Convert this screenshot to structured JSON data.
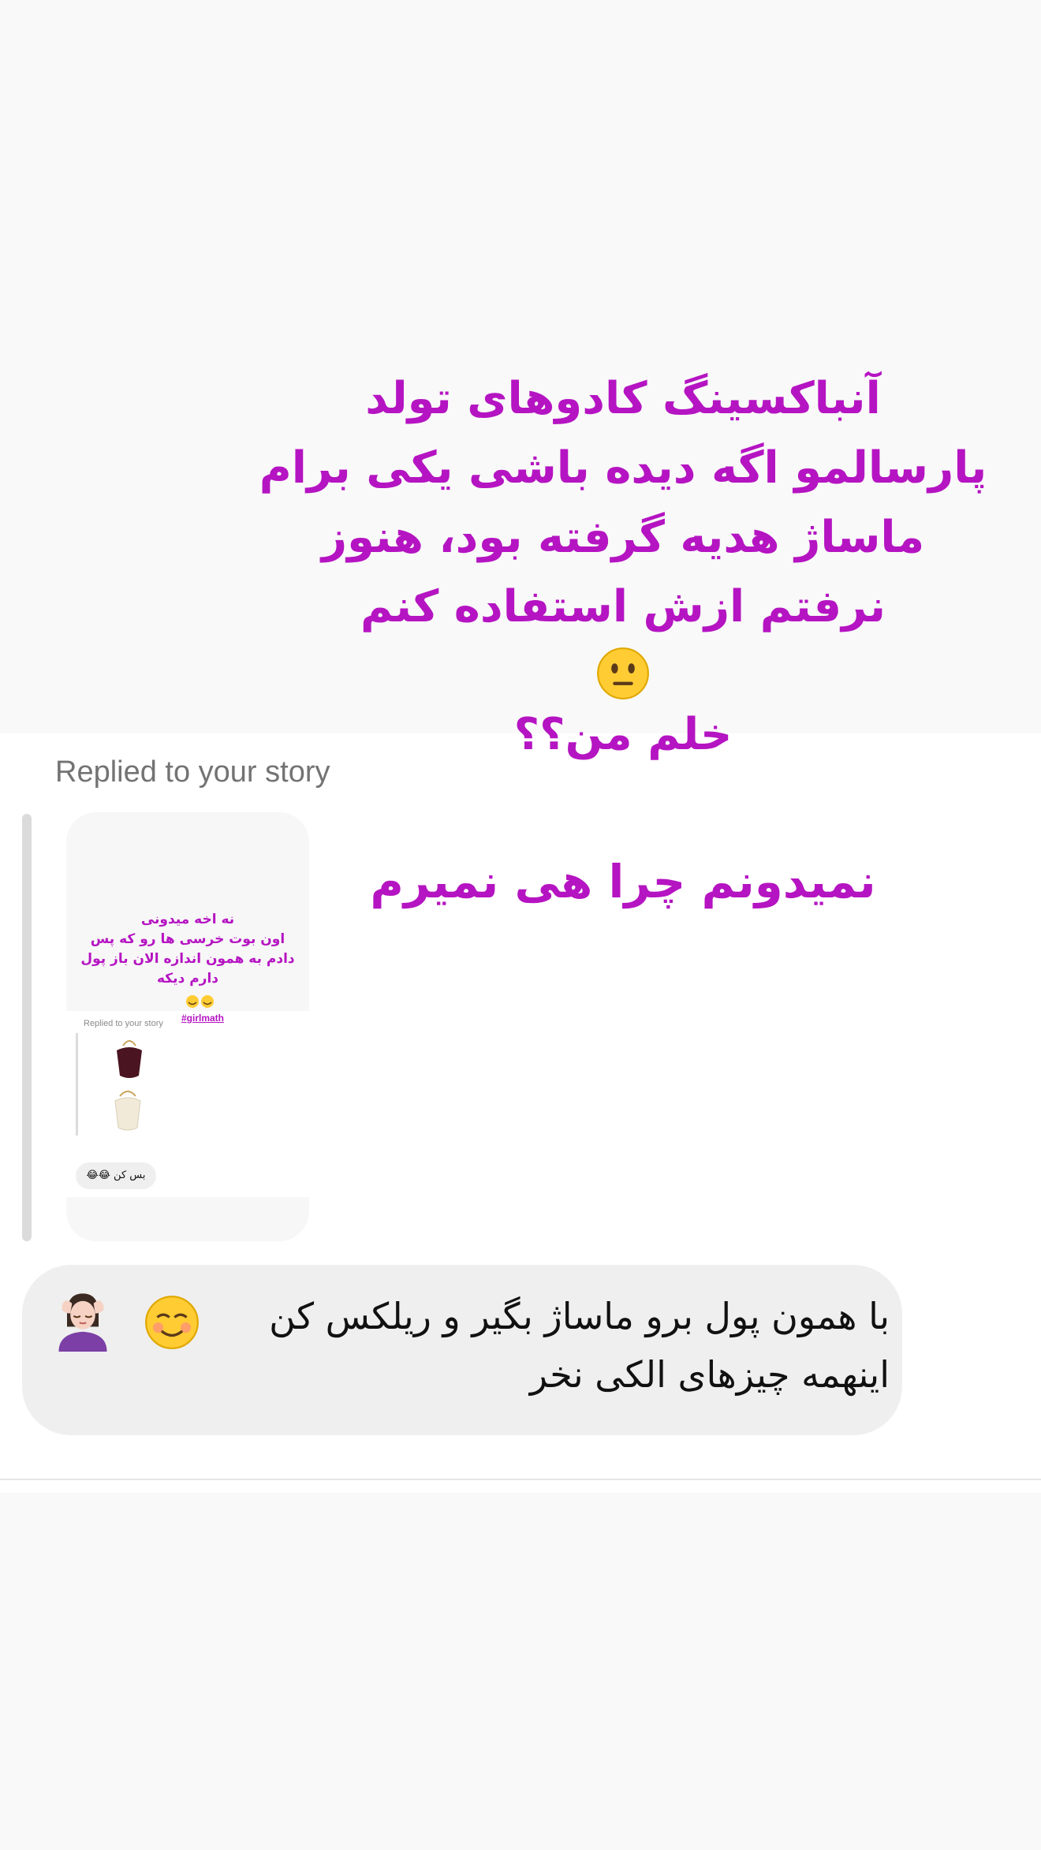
{
  "story_overlay": {
    "lines": [
      "آنباکسینگ کادوهای تولد",
      "پارسالمو اگه دیده باشی یکی برام",
      "ماساژ هدیه گرفته بود، هنوز",
      "نرفتم ازش استفاده کنم"
    ],
    "emoji": "neutral-face-icon",
    "last_line": "خلم من؟؟",
    "caption2": "نمیدونم چرا هی نمیرم"
  },
  "reply": {
    "label": "Replied to your story",
    "thumbnail": {
      "lines": [
        "نه اخه میدونی",
        "اون بوت خرسی ها رو که پس",
        "دادم به همون اندازه الان باز پول",
        "دارم دیکه"
      ],
      "hashtag": "#girlmath",
      "inner_replied": "Replied to your story",
      "inner_bubble": "بس کن 😂😂"
    }
  },
  "message": {
    "line1": "با همون پول برو ماساژ بگیر و ریلکس کن",
    "line2": "اینهمه چیزهای الکی نخر",
    "emojis": [
      "smiling-face-icon",
      "person-getting-massage-icon"
    ]
  },
  "colors": {
    "overlay_text": "#b514c2",
    "bubble": "#efefef",
    "label": "#737373"
  }
}
